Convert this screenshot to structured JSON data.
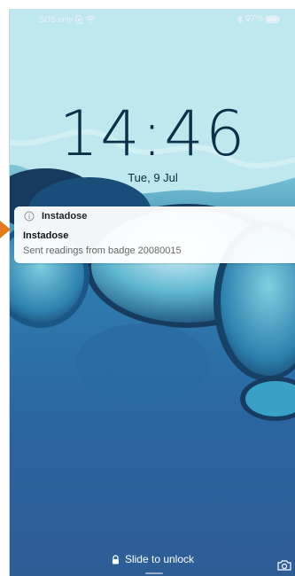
{
  "status": {
    "carrier_text": "SOS only",
    "battery_percent": "97%",
    "icons": [
      "sim-icon",
      "wifi-icon",
      "bluetooth-icon",
      "battery-icon"
    ]
  },
  "lockscreen": {
    "time": "14:46",
    "date": "Tue, 9 Jul"
  },
  "notification": {
    "app_name": "Instadose",
    "title": "Instadose",
    "body": "Sent readings from badge 20080015",
    "icon": "info-icon"
  },
  "footer": {
    "unlock_label": "Slide to unlock",
    "lock_icon": "lock-icon",
    "camera_icon": "camera-icon"
  },
  "colors": {
    "pointer": "#e07a1a",
    "clock": "#0b3148"
  }
}
